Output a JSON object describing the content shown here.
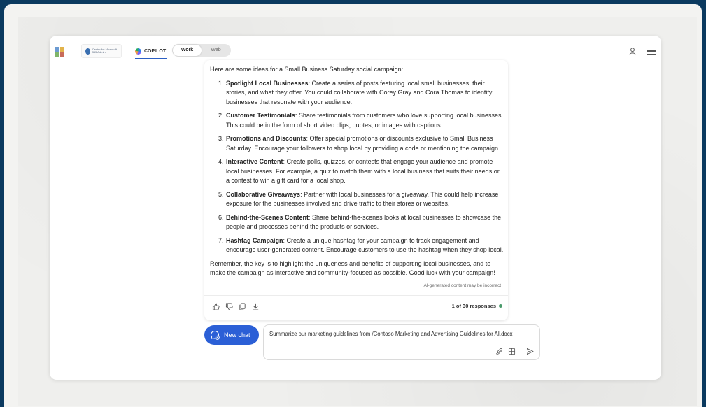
{
  "header": {
    "org_logo_text": "Center for Microsoft 365 Admin",
    "copilot_label": "COPILOT",
    "mode_options": [
      "Work",
      "Web"
    ],
    "active_mode": "Work"
  },
  "response": {
    "intro": "Here are some ideas for a Small Business Saturday social campaign:",
    "items": [
      {
        "title": "Spotlight Local Businesses",
        "text": ": Create a series of posts featuring local small businesses, their stories, and what they offer. You could collaborate with Corey Gray and Cora Thomas to identify businesses that resonate with your audience."
      },
      {
        "title": "Customer Testimonials",
        "text": ": Share testimonials from customers who love supporting local businesses. This could be in the form of short video clips, quotes, or images with captions."
      },
      {
        "title": "Promotions and Discounts",
        "text": ": Offer special promotions or discounts exclusive to Small Business Saturday. Encourage your followers to shop local by providing a code or mentioning the campaign."
      },
      {
        "title": "Interactive Content",
        "text": ": Create polls, quizzes, or contests that engage your audience and promote local businesses. For example, a quiz to match them with a local business that suits their needs or a contest to win a gift card for a local shop."
      },
      {
        "title": "Collaborative Giveaways",
        "text": ": Partner with local businesses for a giveaway. This could help increase exposure for the businesses involved and drive traffic to their stores or websites."
      },
      {
        "title": "Behind-the-Scenes Content",
        "text": ": Share behind-the-scenes looks at local businesses to showcase the people and processes behind the products or services."
      },
      {
        "title": "Hashtag Campaign",
        "text": ": Create a unique hashtag for your campaign to track engagement and encourage user-generated content. Encourage customers to use the hashtag when they shop local."
      }
    ],
    "closing": "Remember, the key is to highlight the uniqueness and benefits of supporting local businesses, and to make the campaign as interactive and community-focused as possible. Good luck with your campaign!",
    "disclaimer": "AI-generated content may be incorrect",
    "response_count": "1 of 30 responses"
  },
  "composer": {
    "new_chat_label": "New chat",
    "prompt_text": "Summarize our marketing guidelines from /Contoso Marketing and Advertising Guidelines for AI.docx"
  },
  "icons": {
    "feedback": [
      "thumbs-up-icon",
      "thumbs-down-icon",
      "copy-icon",
      "download-icon"
    ],
    "input_tools": [
      "paperclip-icon",
      "apps-icon",
      "send-icon"
    ]
  },
  "colors": {
    "accent": "#2b5fd6",
    "status_dot": "#4a9b6b",
    "outer_background": "#0b3a5f"
  }
}
